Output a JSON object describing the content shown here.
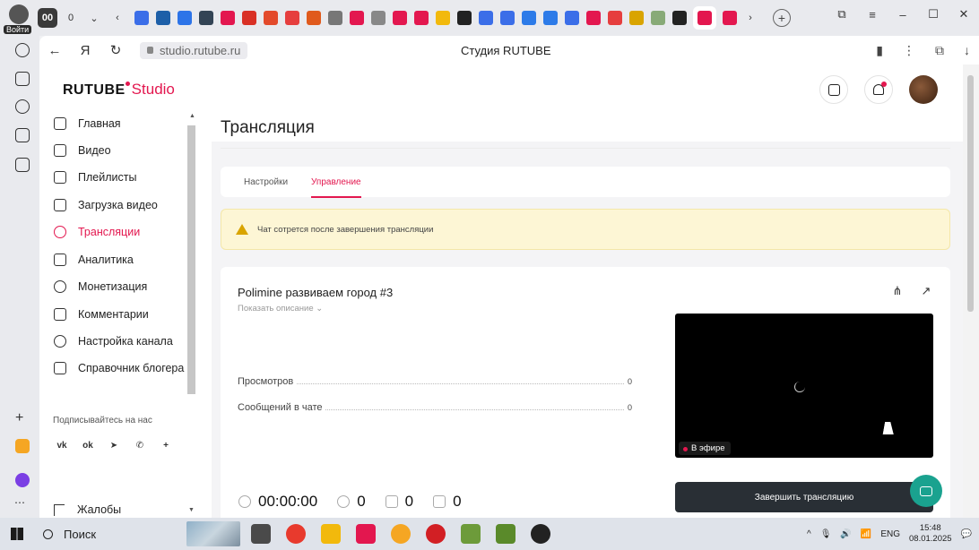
{
  "browser": {
    "profile_label": "Войти",
    "tab_counts": [
      "00",
      "0"
    ],
    "url": "studio.rutube.ru",
    "page_title": "Студия RUTUBE",
    "accent_color": "#e3174f"
  },
  "header": {
    "logo_main": "RUTUBE",
    "logo_sub": "Studio"
  },
  "sidebar": {
    "items": [
      {
        "label": "Главная",
        "icon": "home-icon"
      },
      {
        "label": "Видео",
        "icon": "video-icon"
      },
      {
        "label": "Плейлисты",
        "icon": "playlist-icon"
      },
      {
        "label": "Загрузка видео",
        "icon": "upload-icon"
      },
      {
        "label": "Трансляции",
        "icon": "broadcast-icon",
        "active": true
      },
      {
        "label": "Аналитика",
        "icon": "analytics-icon"
      },
      {
        "label": "Монетизация",
        "icon": "monetization-icon"
      },
      {
        "label": "Комментарии",
        "icon": "comments-icon"
      },
      {
        "label": "Настройка канала",
        "icon": "settings-icon"
      },
      {
        "label": "Справочник блогера",
        "icon": "help-icon"
      }
    ],
    "subscribe_label": "Подписывайтесь на нас",
    "social": [
      "vk",
      "ok",
      "telegram",
      "viber",
      "more"
    ],
    "complaints_label": "Жалобы"
  },
  "main": {
    "title": "Трансляция",
    "tabs": [
      {
        "label": "Настройки",
        "active": false
      },
      {
        "label": "Управление",
        "active": true
      }
    ],
    "warning": "Чат сотрется после завершения трансляции",
    "stream": {
      "title": "Polimine развиваем город #3",
      "show_description": "Показать описание",
      "stats": [
        {
          "label": "Просмотров",
          "value": "0"
        },
        {
          "label": "Сообщений в чате",
          "value": "0"
        }
      ],
      "on_air_label": "В эфире",
      "duration": "00:00:00",
      "viewers": "0",
      "likes": "0",
      "dislikes": "0",
      "end_button": "Завершить трансляцию"
    }
  },
  "taskbar": {
    "search_label": "Поиск",
    "lang": "ENG",
    "time": "15:48",
    "date": "08.01.2025"
  }
}
